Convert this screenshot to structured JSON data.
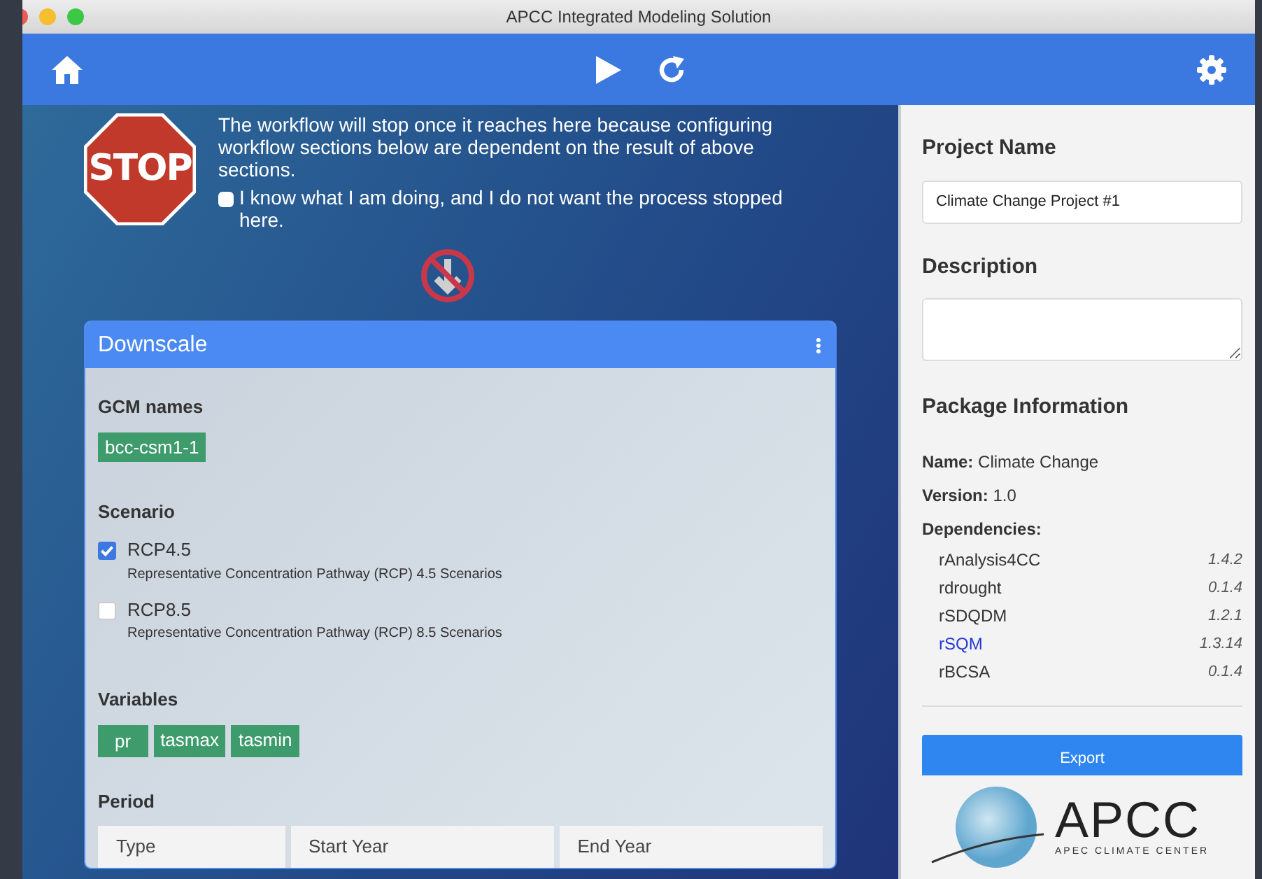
{
  "window": {
    "title": "APCC Integrated Modeling Solution"
  },
  "toolbar": {
    "buttons": [
      {
        "kind": "home"
      },
      {
        "kind": "run"
      },
      {
        "kind": "reload"
      },
      {
        "kind": "settings"
      }
    ]
  },
  "stop_notice": {
    "sign": "STOP",
    "message": "The workflow will stop once it reaches here because configuring workflow sections below are dependent on the result of above sections.",
    "override": {
      "label": "I know what I am doing, and I do not want the process stopped here.",
      "checked": false
    }
  },
  "panel": {
    "title": "Downscale",
    "gcm_names": {
      "label": "GCM names",
      "tags": [
        "bcc-csm1-1"
      ]
    },
    "scenario": {
      "label": "Scenario",
      "options": [
        {
          "name": "RCP4.5",
          "description": "Representative Concentration Pathway (RCP) 4.5 Scenarios",
          "checked": true
        },
        {
          "name": "RCP8.5",
          "description": "Representative Concentration Pathway (RCP) 8.5 Scenarios",
          "checked": false
        }
      ]
    },
    "variables": {
      "label": "Variables",
      "tags": [
        "pr",
        "tasmax",
        "tasmin"
      ]
    },
    "period": {
      "label": "Period",
      "columns": [
        "Type",
        "Start Year",
        "End Year"
      ]
    }
  },
  "sidebar": {
    "project_name": {
      "label": "Project Name",
      "value": "Climate Change Project #1"
    },
    "description": {
      "label": "Description"
    },
    "package": {
      "label": "Package Information",
      "name_label": "Name:",
      "name": "Climate Change",
      "version_label": "Version:",
      "version": "1.0",
      "dependencies_label": "Dependencies:",
      "dependencies": [
        {
          "name": "rAnalysis4CC",
          "version": "1.4.2",
          "selected": false
        },
        {
          "name": "rdrought",
          "version": "0.1.4",
          "selected": false
        },
        {
          "name": "rSDQDM",
          "version": "1.2.1",
          "selected": false
        },
        {
          "name": "rSQM",
          "version": "1.3.14",
          "selected": true
        },
        {
          "name": "rBCSA",
          "version": "0.1.4",
          "selected": false
        }
      ]
    },
    "export_button": "Export",
    "logo": {
      "name": "APCC",
      "subtitle": "APEC CLIMATE CENTER"
    }
  }
}
